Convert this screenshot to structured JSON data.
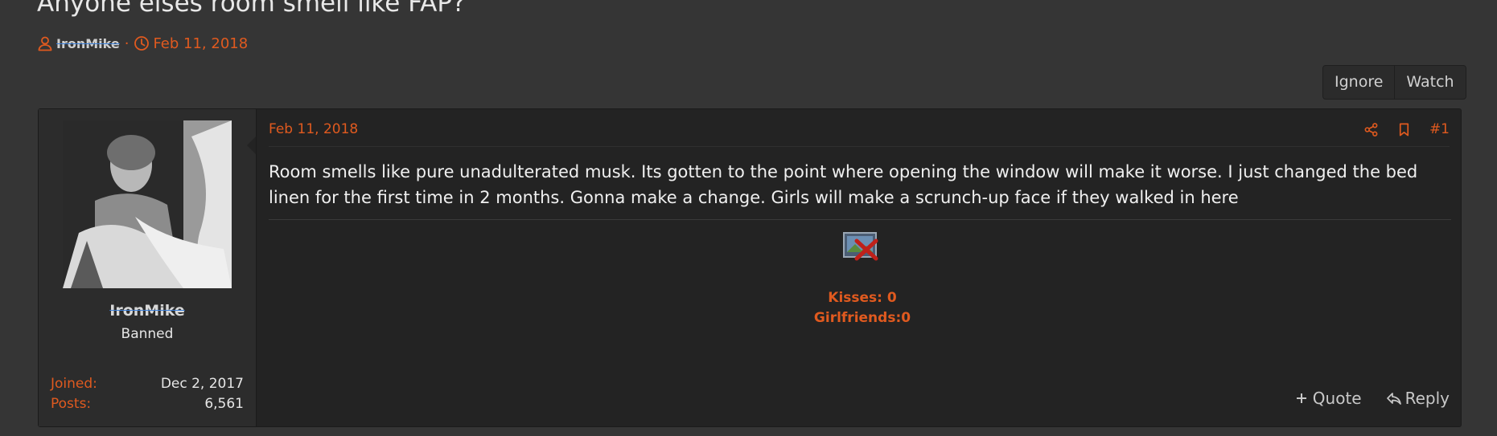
{
  "thread": {
    "title": "Anyone elses room smell like FAP?",
    "author": "IronMike",
    "separator": "·",
    "date": "Feb 11, 2018"
  },
  "buttons": {
    "ignore": "Ignore",
    "watch": "Watch"
  },
  "post": {
    "date": "Feb 11, 2018",
    "number": "#1",
    "body": "Room smells like pure unadulterated musk. Its gotten to the point where opening the window will make it worse.  I just changed the bed linen for the first time in 2 months.  Gonna make a change. Girls will make a scrunch-up face if they walked in here",
    "signature": {
      "kisses": "Kisses: 0",
      "girlfriends": "Girlfriends:0"
    },
    "footer": {
      "quote": "Quote",
      "reply": "Reply"
    }
  },
  "poster": {
    "name": "IronMike",
    "user_title": "Banned",
    "stats": [
      {
        "label": "Joined:",
        "value": "Dec 2, 2017"
      },
      {
        "label": "Posts:",
        "value": "6,561"
      }
    ]
  },
  "colors": {
    "accent": "#e05a1f",
    "background": "#353535",
    "post_background": "#232323",
    "strike_blue": "#3a7ed8"
  },
  "icons": {
    "author": "user-icon",
    "date": "clock-icon",
    "share": "share-icon",
    "bookmark": "bookmark-icon",
    "broken_image": "broken-image-icon",
    "quote": "plus-icon",
    "reply": "reply-icon"
  }
}
